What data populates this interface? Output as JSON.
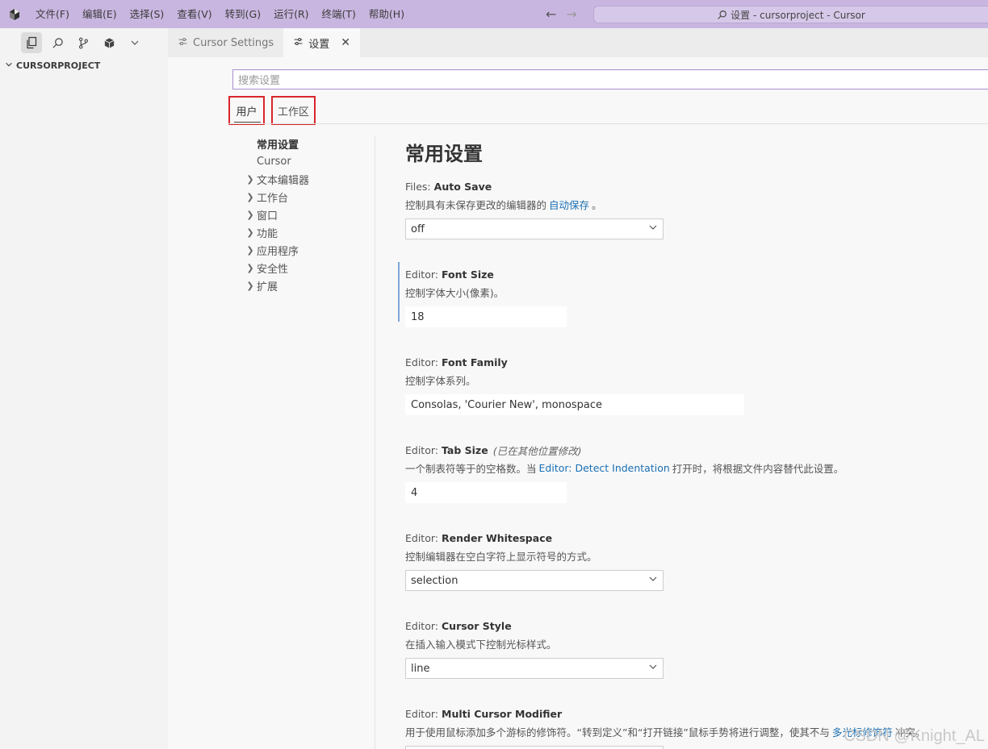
{
  "titlebar": {
    "menu": [
      "文件(F)",
      "编辑(E)",
      "选择(S)",
      "查看(V)",
      "转到(G)",
      "运行(R)",
      "终端(T)",
      "帮助(H)"
    ],
    "command_center": "设置 - cursorproject - Cursor",
    "back_icon": "arrow-left-icon",
    "forward_icon": "arrow-right-icon"
  },
  "sidebar": {
    "toolbar_icons": [
      "explorer-icon",
      "search-icon",
      "source-control-icon",
      "extensions-icon",
      "chevron-down-icon"
    ],
    "explorer_title": "CURSORPROJECT"
  },
  "tabs": [
    {
      "label": "Cursor Settings",
      "active": false
    },
    {
      "label": "设置",
      "active": true
    }
  ],
  "search": {
    "placeholder": "搜索设置"
  },
  "scope_tabs": {
    "user": "用户",
    "workspace": "工作区"
  },
  "toc": {
    "items": [
      {
        "label": "常用设置",
        "bold": true,
        "expandable": false
      },
      {
        "label": "Cursor",
        "bold": false,
        "expandable": false
      },
      {
        "label": "文本编辑器",
        "bold": false,
        "expandable": true
      },
      {
        "label": "工作台",
        "bold": false,
        "expandable": true
      },
      {
        "label": "窗口",
        "bold": false,
        "expandable": true
      },
      {
        "label": "功能",
        "bold": false,
        "expandable": true
      },
      {
        "label": "应用程序",
        "bold": false,
        "expandable": true
      },
      {
        "label": "安全性",
        "bold": false,
        "expandable": true
      },
      {
        "label": "扩展",
        "bold": false,
        "expandable": true
      }
    ]
  },
  "content": {
    "section_title": "常用设置",
    "settings": {
      "auto_save": {
        "category": "Files:",
        "name": "Auto Save",
        "desc_pre": "控制具有未保存更改的编辑器的",
        "desc_link": "自动保存",
        "desc_post": "。",
        "value": "off"
      },
      "font_size": {
        "category": "Editor:",
        "name": "Font Size",
        "desc": "控制字体大小(像素)。",
        "value": "18"
      },
      "font_family": {
        "category": "Editor:",
        "name": "Font Family",
        "desc": "控制字体系列。",
        "value": "Consolas, 'Courier New', monospace"
      },
      "tab_size": {
        "category": "Editor:",
        "name": "Tab Size",
        "modified": "(已在其他位置修改)",
        "desc_pre": "一个制表符等于的空格数。当",
        "desc_link": "Editor: Detect Indentation",
        "desc_post": "打开时，将根据文件内容替代此设置。",
        "value": "4"
      },
      "render_whitespace": {
        "category": "Editor:",
        "name": "Render Whitespace",
        "desc": "控制编辑器在空白字符上显示符号的方式。",
        "value": "selection"
      },
      "cursor_style": {
        "category": "Editor:",
        "name": "Cursor Style",
        "desc": "在插入输入模式下控制光标样式。",
        "value": "line"
      },
      "multi_cursor": {
        "category": "Editor:",
        "name": "Multi Cursor Modifier",
        "desc_pre": "用于使用鼠标添加多个游标的修饰符。“转到定义”和“打开链接”鼠标手势将进行调整，使其不与",
        "desc_link": "多光标修饰符",
        "desc_post": "冲突。"
      }
    }
  },
  "watermark": "CSDN @Knight_AL"
}
